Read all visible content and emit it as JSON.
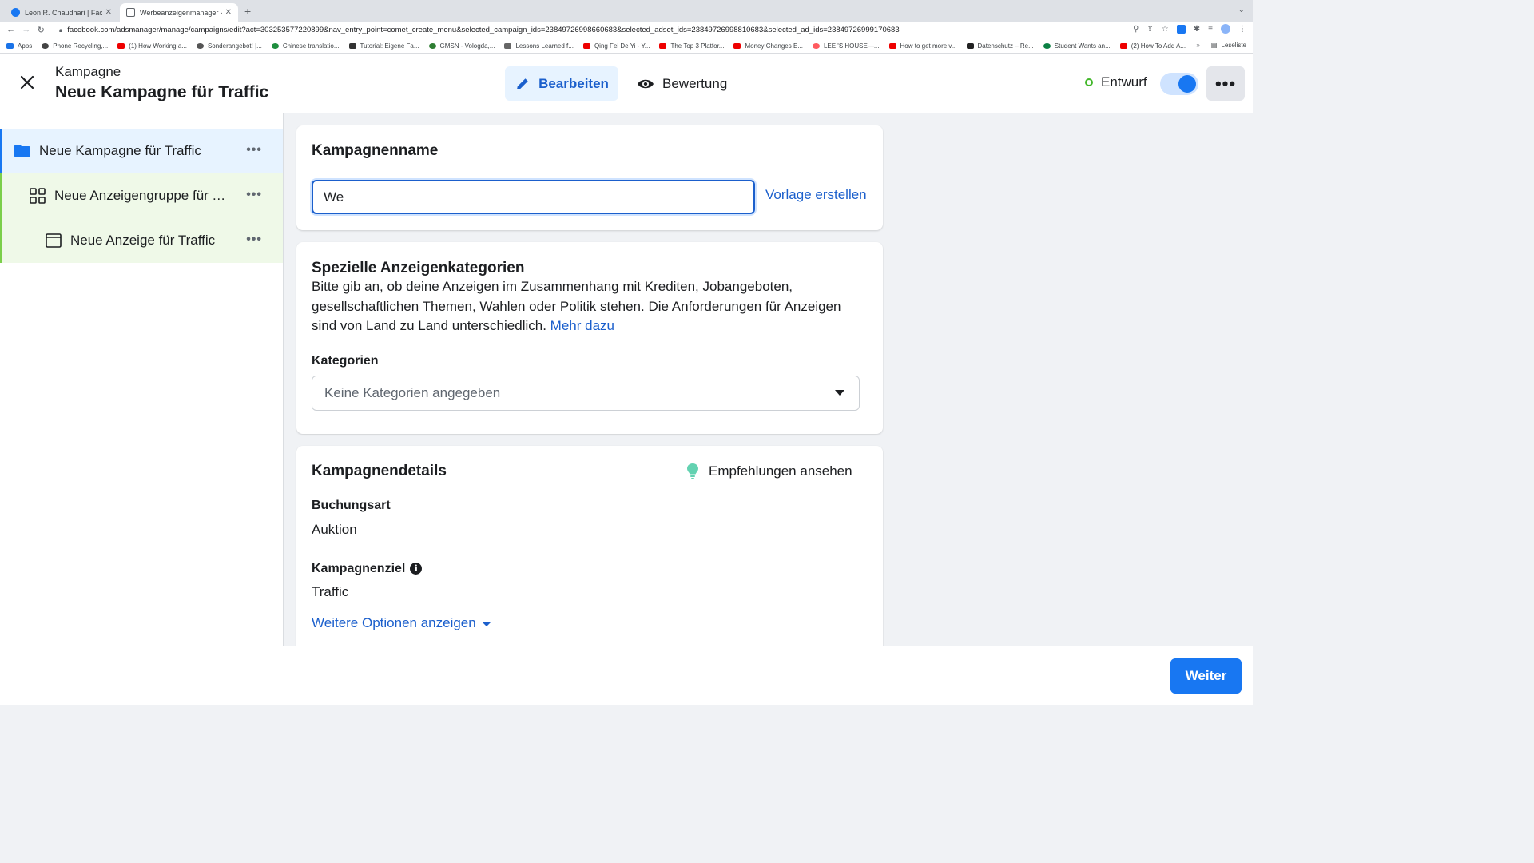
{
  "browser": {
    "tabs": [
      {
        "title": "Leon R. Chaudhari | Facebook",
        "active": false
      },
      {
        "title": "Werbeanzeigenmanager - Wer",
        "active": true
      }
    ],
    "url": "facebook.com/adsmanager/manage/campaigns/edit?act=303253577220899&nav_entry_point=comet_create_menu&selected_campaign_ids=23849726998660683&selected_adset_ids=23849726998810683&selected_ad_ids=23849726999170683",
    "bookmarks": [
      "Apps",
      "Phone Recycling,...",
      "(1) How Working a...",
      "Sonderangebot! |...",
      "Chinese translatio...",
      "Tutorial: Eigene Fa...",
      "GMSN - Vologda,...",
      "Lessons Learned f...",
      "Qing Fei De Yi - Y...",
      "The Top 3 Platfor...",
      "Money Changes E...",
      "LEE 'S HOUSE—...",
      "How to get more v...",
      "Datenschutz – Re...",
      "Student Wants an...",
      "(2) How To Add A..."
    ],
    "reading_list": "Leseliste"
  },
  "header": {
    "subtitle": "Kampagne",
    "title": "Neue Kampagne für Traffic",
    "tab_edit": "Bearbeiten",
    "tab_review": "Bewertung",
    "status": "Entwurf"
  },
  "sidebar": {
    "items": [
      {
        "label": "Neue Kampagne für Traffic"
      },
      {
        "label": "Neue Anzeigengruppe für Traffic"
      },
      {
        "label": "Neue Anzeige für Traffic"
      }
    ]
  },
  "campaign_name": {
    "title": "Kampagnenname",
    "value": "We",
    "template_link": "Vorlage erstellen"
  },
  "special_categories": {
    "title": "Spezielle Anzeigenkategorien",
    "description": "Bitte gib an, ob deine Anzeigen im Zusammenhang mit Krediten, Jobangeboten, gesellschaftlichen Themen, Wahlen oder Politik stehen. Die Anforderungen für Anzeigen sind von Land zu Land unterschiedlich.",
    "more_link": "Mehr dazu",
    "categories_label": "Kategorien",
    "categories_value": "Keine Kategorien angegeben"
  },
  "details": {
    "title": "Kampagnendetails",
    "recommendations": "Empfehlungen ansehen",
    "booking_label": "Buchungsart",
    "booking_value": "Auktion",
    "goal_label": "Kampagnenziel",
    "goal_value": "Traffic",
    "more_options": "Weitere Optionen anzeigen"
  },
  "footer": {
    "next": "Weiter"
  }
}
